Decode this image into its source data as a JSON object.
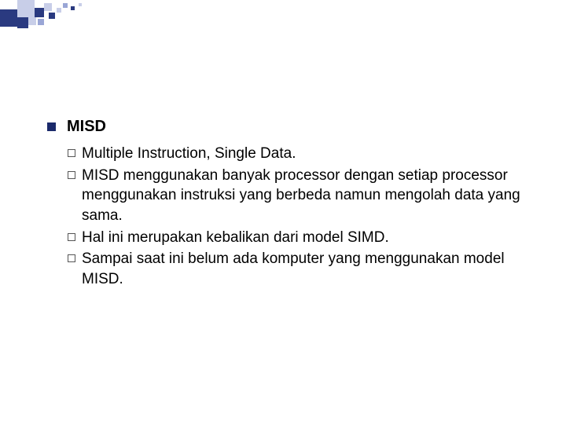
{
  "heading": "MISD",
  "items": [
    "Multiple Instruction, Single Data.",
    "MISD menggunakan banyak processor dengan setiap processor menggunakan instruksi yang berbeda namun mengolah data yang sama.",
    "Hal ini merupakan kebalikan dari model SIMD.",
    "Sampai saat ini belum ada komputer yang menggunakan model MISD."
  ],
  "deco_colors": {
    "dark": "#2a3a80",
    "light": "#c8cee8",
    "mid": "#9aa6d6"
  }
}
